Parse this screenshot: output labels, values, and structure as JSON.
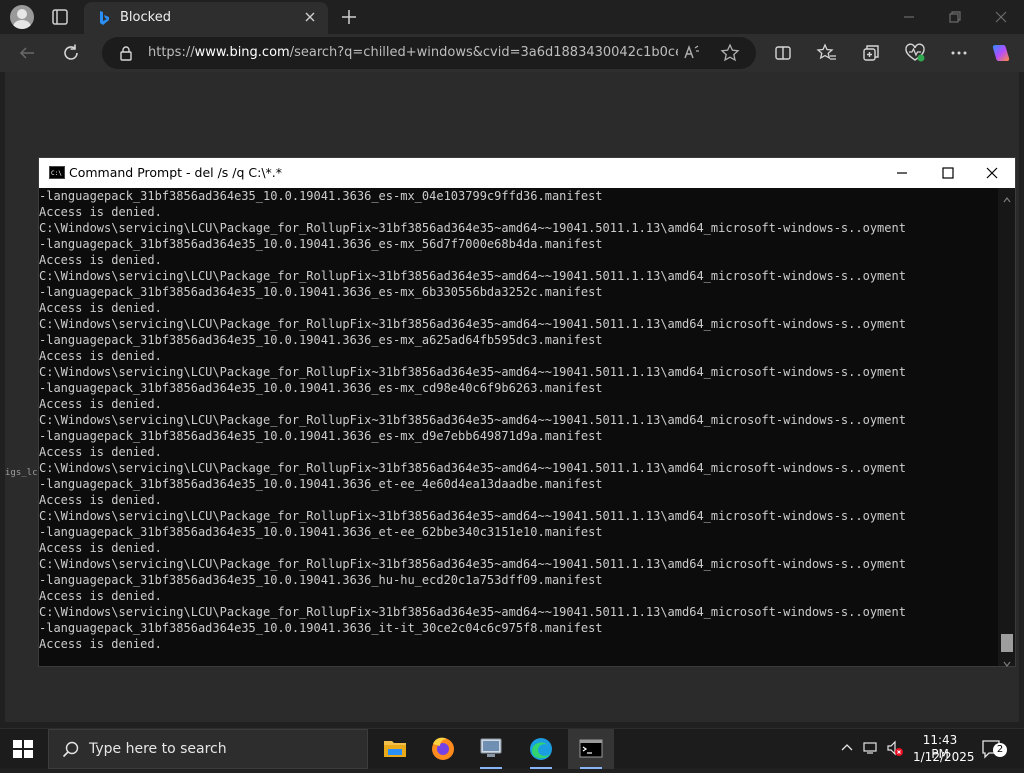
{
  "browser": {
    "tab_title": "Blocked",
    "url_prefix": "https://",
    "url_domain": "www.bing.com",
    "url_rest": "/search?q=chilled+windows&cvid=3a6d1883430042c1b0ce..."
  },
  "page": {
    "side_fragment": "igs_lc"
  },
  "console": {
    "title": "Command Prompt - del  /s /q C:\\*.*",
    "lines": [
      "-languagepack_31bf3856ad364e35_10.0.19041.3636_es-mx_04e103799c9ffd36.manifest",
      "Access is denied.",
      "C:\\Windows\\servicing\\LCU\\Package_for_RollupFix~31bf3856ad364e35~amd64~~19041.5011.1.13\\amd64_microsoft-windows-s..oyment",
      "-languagepack_31bf3856ad364e35_10.0.19041.3636_es-mx_56d7f7000e68b4da.manifest",
      "Access is denied.",
      "C:\\Windows\\servicing\\LCU\\Package_for_RollupFix~31bf3856ad364e35~amd64~~19041.5011.1.13\\amd64_microsoft-windows-s..oyment",
      "-languagepack_31bf3856ad364e35_10.0.19041.3636_es-mx_6b330556bda3252c.manifest",
      "Access is denied.",
      "C:\\Windows\\servicing\\LCU\\Package_for_RollupFix~31bf3856ad364e35~amd64~~19041.5011.1.13\\amd64_microsoft-windows-s..oyment",
      "-languagepack_31bf3856ad364e35_10.0.19041.3636_es-mx_a625ad64fb595dc3.manifest",
      "Access is denied.",
      "C:\\Windows\\servicing\\LCU\\Package_for_RollupFix~31bf3856ad364e35~amd64~~19041.5011.1.13\\amd64_microsoft-windows-s..oyment",
      "-languagepack_31bf3856ad364e35_10.0.19041.3636_es-mx_cd98e40c6f9b6263.manifest",
      "Access is denied.",
      "C:\\Windows\\servicing\\LCU\\Package_for_RollupFix~31bf3856ad364e35~amd64~~19041.5011.1.13\\amd64_microsoft-windows-s..oyment",
      "-languagepack_31bf3856ad364e35_10.0.19041.3636_es-mx_d9e7ebb649871d9a.manifest",
      "Access is denied.",
      "C:\\Windows\\servicing\\LCU\\Package_for_RollupFix~31bf3856ad364e35~amd64~~19041.5011.1.13\\amd64_microsoft-windows-s..oyment",
      "-languagepack_31bf3856ad364e35_10.0.19041.3636_et-ee_4e60d4ea13daadbe.manifest",
      "Access is denied.",
      "C:\\Windows\\servicing\\LCU\\Package_for_RollupFix~31bf3856ad364e35~amd64~~19041.5011.1.13\\amd64_microsoft-windows-s..oyment",
      "-languagepack_31bf3856ad364e35_10.0.19041.3636_et-ee_62bbe340c3151e10.manifest",
      "Access is denied.",
      "C:\\Windows\\servicing\\LCU\\Package_for_RollupFix~31bf3856ad364e35~amd64~~19041.5011.1.13\\amd64_microsoft-windows-s..oyment",
      "-languagepack_31bf3856ad364e35_10.0.19041.3636_hu-hu_ecd20c1a753dff09.manifest",
      "Access is denied.",
      "C:\\Windows\\servicing\\LCU\\Package_for_RollupFix~31bf3856ad364e35~amd64~~19041.5011.1.13\\amd64_microsoft-windows-s..oyment",
      "-languagepack_31bf3856ad364e35_10.0.19041.3636_it-it_30ce2c04c6c975f8.manifest",
      "Access is denied."
    ]
  },
  "taskbar": {
    "search_placeholder": "Type here to search",
    "time": "11:43 PM",
    "date": "1/12/2025",
    "notification_count": "2"
  },
  "colors": {
    "console_bg": "#0c0c0c",
    "console_text": "#cccccc",
    "browser_bg": "#202020",
    "taskbar_bg": "#1c1c1c"
  }
}
